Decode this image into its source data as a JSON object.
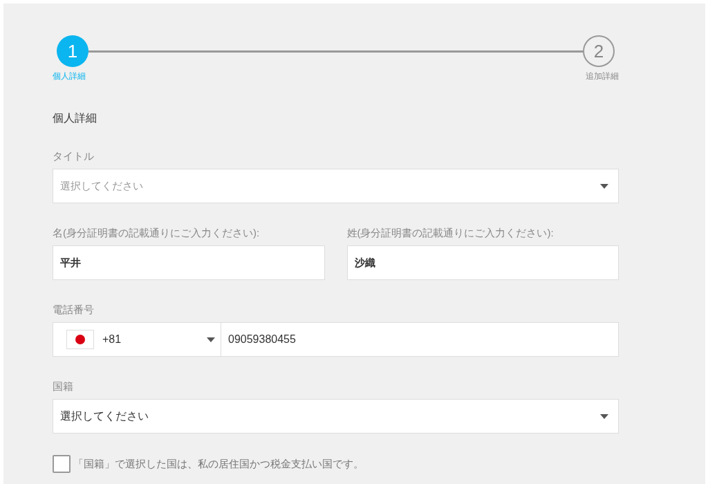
{
  "stepper": [
    {
      "number": "1",
      "label": "個人詳細",
      "selected": true
    },
    {
      "number": "2",
      "label": "追加詳細",
      "selected": false
    }
  ],
  "section_title": "個人詳細",
  "title_field": {
    "label": "タイトル",
    "placeholder": "選択してください"
  },
  "first_name": {
    "label": "名(身分証明書の記載通りにご入力ください):",
    "value": "平井"
  },
  "last_name": {
    "label": "姓(身分証明書の記載通りにご入力ください):",
    "value": "沙織"
  },
  "phone": {
    "label": "電話番号",
    "country_code": "+81",
    "value": "09059380455"
  },
  "nationality": {
    "label": "国籍",
    "value": "選択してください"
  },
  "residence_checkbox": {
    "label": "「国籍」で選択した国は、私の居住国かつ税金支払い国です。",
    "checked": false
  }
}
